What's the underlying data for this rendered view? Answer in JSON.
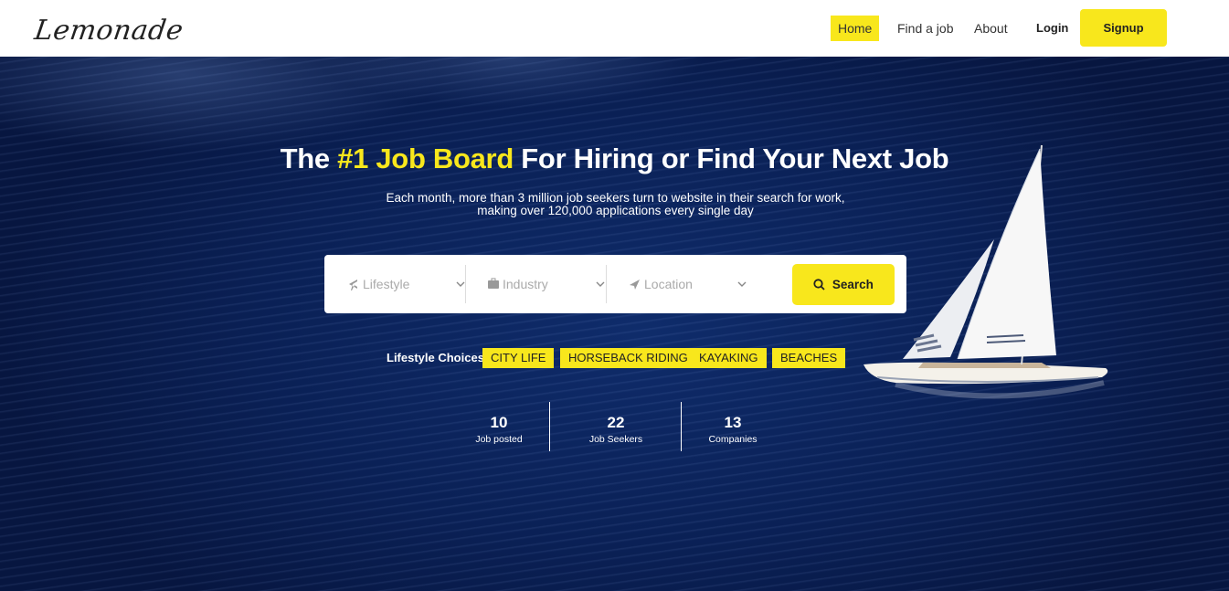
{
  "brand": {
    "logo_text": "Lemonade"
  },
  "nav": {
    "items": [
      "Home",
      "Find a job",
      "About"
    ],
    "login": "Login",
    "signup": "Signup"
  },
  "hero": {
    "title_prefix": "The ",
    "title_highlight": "#1 Job Board",
    "title_suffix": " For Hiring or Find Your Next Job",
    "subtitle": "Each month, more than 3 million job seekers turn to website in their search for work, making over 120,000 applications every single day"
  },
  "search": {
    "lifestyle": "Lifestyle",
    "industry": "Industry",
    "location": "Location",
    "button": "Search"
  },
  "lifestyle_choices": {
    "label": "Lifestyle Choices:",
    "chips": [
      "CITY LIFE",
      "HORSEBACK RIDING",
      "KAYAKING",
      "BEACHES"
    ]
  },
  "stats": [
    {
      "value": "10",
      "label": "Job posted"
    },
    {
      "value": "22",
      "label": "Job Seekers"
    },
    {
      "value": "13",
      "label": "Companies"
    }
  ],
  "colors": {
    "accent": "#f8e71c",
    "hero_bg": "#0a2055"
  }
}
